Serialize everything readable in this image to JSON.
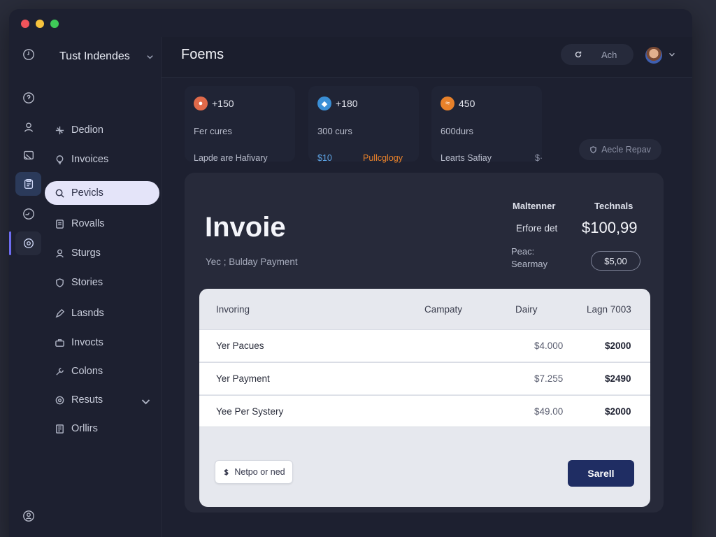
{
  "app": {
    "workspace_name": "Tust Indendes",
    "page_title": "Foems"
  },
  "header": {
    "search_text": "Ach"
  },
  "sidebar": {
    "items": [
      {
        "label": "Dedion",
        "icon": "sparkle-icon"
      },
      {
        "label": "Invoices",
        "icon": "bulb-icon"
      },
      {
        "label": "Pevicls",
        "icon": "search-icon"
      },
      {
        "label": "Rovalls",
        "icon": "file-icon"
      },
      {
        "label": "Sturgs",
        "icon": "user-icon"
      },
      {
        "label": "Stories",
        "icon": "shield-icon"
      },
      {
        "label": "Lasnds",
        "icon": "pen-icon"
      },
      {
        "label": "Invocts",
        "icon": "briefcase-icon"
      },
      {
        "label": "Colons",
        "icon": "wrench-icon"
      },
      {
        "label": "Resuts",
        "icon": "gear-icon"
      },
      {
        "label": "Orllirs",
        "icon": "document-icon"
      }
    ],
    "active_index": 2
  },
  "stats": [
    {
      "value": "+150",
      "sub": "Fer cures",
      "foot": "Lapde are Hafivary",
      "badge_color": "#e06a4a"
    },
    {
      "value": "+180",
      "sub": "300 curs",
      "foot": "$10",
      "foot_2": "Pullcglogy",
      "badge_color": "#3a8fd6"
    },
    {
      "value": "450",
      "sub": "600durs",
      "foot": "Learts Safiay",
      "foot_2": "$·",
      "badge_color": "#e8812a"
    }
  ],
  "ghost_button": "Aecle Repav",
  "invoice": {
    "title": "Invoie",
    "subtitle": "Yec ; Bulday Payment",
    "summary_col1": "Maltenner",
    "summary_col2": "Technals",
    "label_1": "Erfore det",
    "amount": "$100,99",
    "label_2": "Peac: Searmay",
    "pill": "$5,00"
  },
  "table": {
    "headers": [
      "Invoring",
      "Campaty",
      "Dairy",
      "Lagn 7003"
    ],
    "rows": [
      {
        "name": "Yer Pacues",
        "value": "$4.000",
        "total": "$2000"
      },
      {
        "name": "Yer Payment",
        "value": "$7.255",
        "total": "$2490"
      },
      {
        "name": "Yee Per Systery",
        "value": "$49.00",
        "total": "$2000"
      }
    ]
  },
  "actions": {
    "note_label": "Netpo or ned",
    "save_label": "Sarell"
  },
  "colors": {
    "accent": "#6d6cf0",
    "primary_button": "#1f2d63",
    "active_nav": "#e4e4f9"
  }
}
